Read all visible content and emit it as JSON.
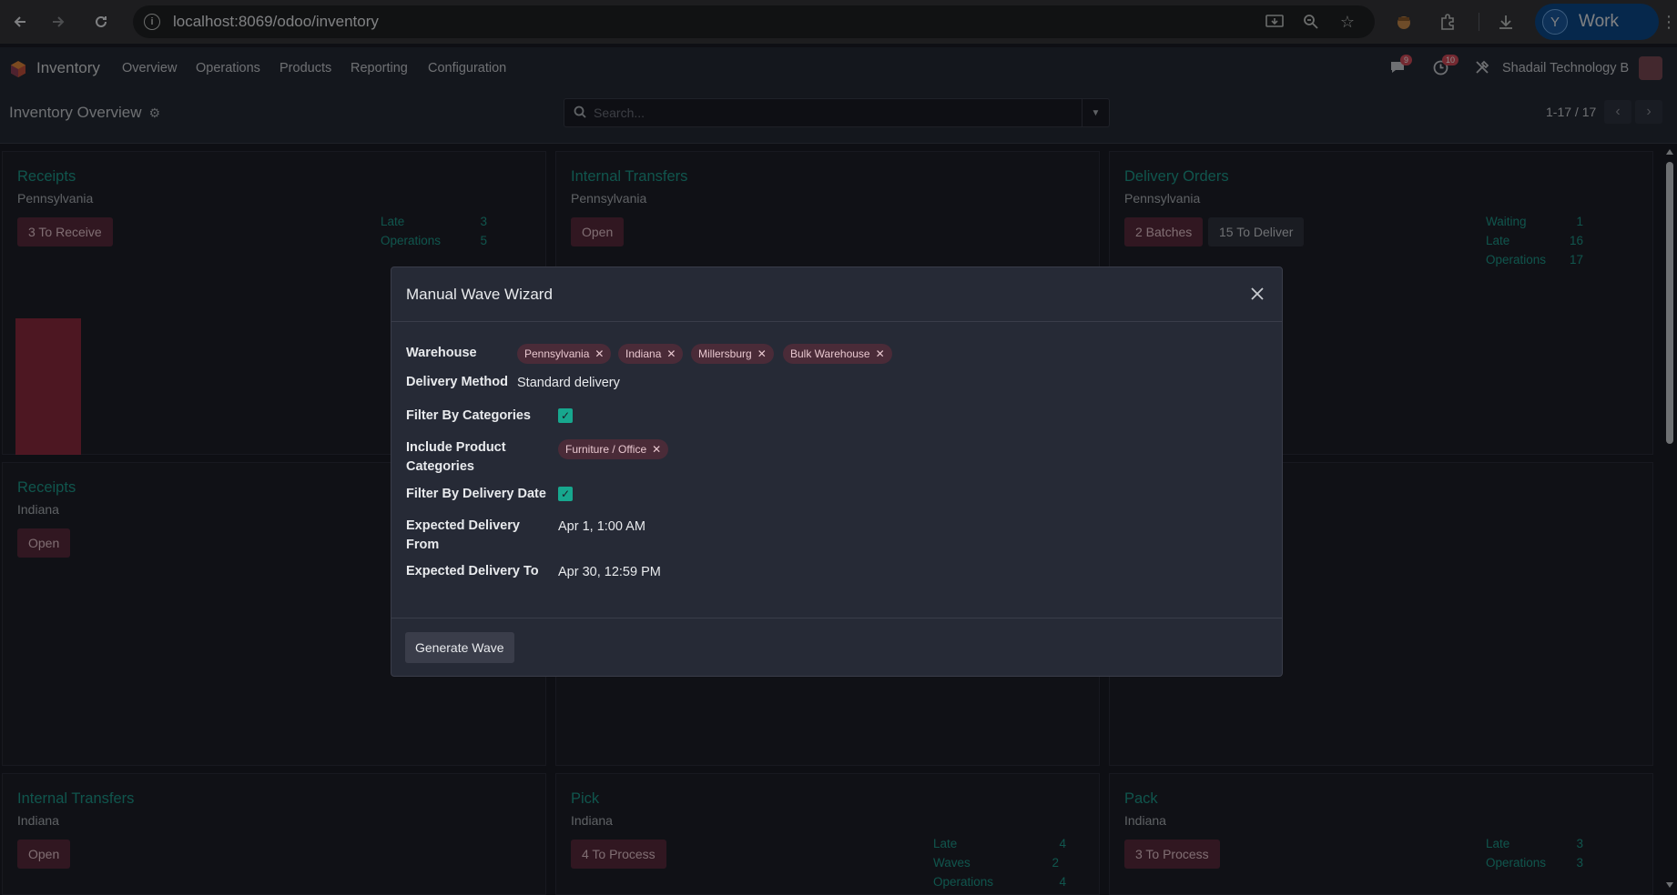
{
  "browser": {
    "url": "localhost:8069/odoo/inventory",
    "profile_initial": "Y",
    "profile_label": "Work"
  },
  "navbar": {
    "app_name": "Inventory",
    "menu": [
      "Overview",
      "Operations",
      "Products",
      "Reporting",
      "Configuration"
    ],
    "messages_badge": "9",
    "activities_badge": "10",
    "company": "Shadail Technology B"
  },
  "control_panel": {
    "breadcrumb": "Inventory Overview",
    "search_placeholder": "Search...",
    "pager": "1-17 / 17"
  },
  "cards": {
    "receipts_pa": {
      "title": "Receipts",
      "sub": "Pennsylvania",
      "button": "3 To Receive",
      "stats": [
        {
          "label": "Late",
          "value": "3"
        },
        {
          "label": "Operations",
          "value": "5"
        }
      ]
    },
    "internal_pa": {
      "title": "Internal Transfers",
      "sub": "Pennsylvania",
      "button": "Open"
    },
    "delivery_pa": {
      "title": "Delivery Orders",
      "sub": "Pennsylvania",
      "button1": "2 Batches",
      "button2": "15 To Deliver",
      "stats": [
        {
          "label": "Waiting",
          "value": "1"
        },
        {
          "label": "Late",
          "value": "16"
        },
        {
          "label": "Operations",
          "value": "17"
        }
      ]
    },
    "receipts_in": {
      "title": "Receipts",
      "sub": "Indiana",
      "button": "Open"
    },
    "internal_in": {
      "title": "Internal Transfers",
      "sub": "Indiana",
      "button": "Open"
    },
    "pick_in": {
      "title": "Pick",
      "sub": "Indiana",
      "button": "4 To Process",
      "stats": [
        {
          "label": "Late",
          "value": "4"
        },
        {
          "label": "Waves",
          "value": "2"
        },
        {
          "label": "Operations",
          "value": "4"
        }
      ]
    },
    "pack_in": {
      "title": "Pack",
      "sub": "Indiana",
      "button": "3 To Process",
      "stats": [
        {
          "label": "Late",
          "value": "3"
        },
        {
          "label": "Operations",
          "value": "3"
        }
      ]
    }
  },
  "modal": {
    "title": "Manual Wave Wizard",
    "warehouse_label": "Warehouse",
    "warehouses": [
      "Pennsylvania",
      "Indiana",
      "Millersburg",
      "Bulk Warehouse"
    ],
    "delivery_method_label": "Delivery Method",
    "delivery_method_value": "Standard delivery",
    "filter_categories_label": "Filter By Categories",
    "filter_categories_checked": true,
    "include_categories_label_1": "Include Product",
    "include_categories_label_2": "Categories",
    "categories": [
      "Furniture / Office"
    ],
    "filter_date_label": "Filter By Delivery Date",
    "filter_date_checked": true,
    "date_from_label_1": "Expected Delivery",
    "date_from_label_2": "From",
    "date_from_value": "Apr 1, 1:00 AM",
    "date_to_label": "Expected Delivery To",
    "date_to_value": "Apr 30, 12:59 PM",
    "generate_button": "Generate Wave"
  },
  "colors": {
    "accent_teal": "#1e9c8c",
    "primary_button": "#5a2a3c",
    "checkbox": "#17a78e",
    "chart_bar": "#b32d46"
  }
}
